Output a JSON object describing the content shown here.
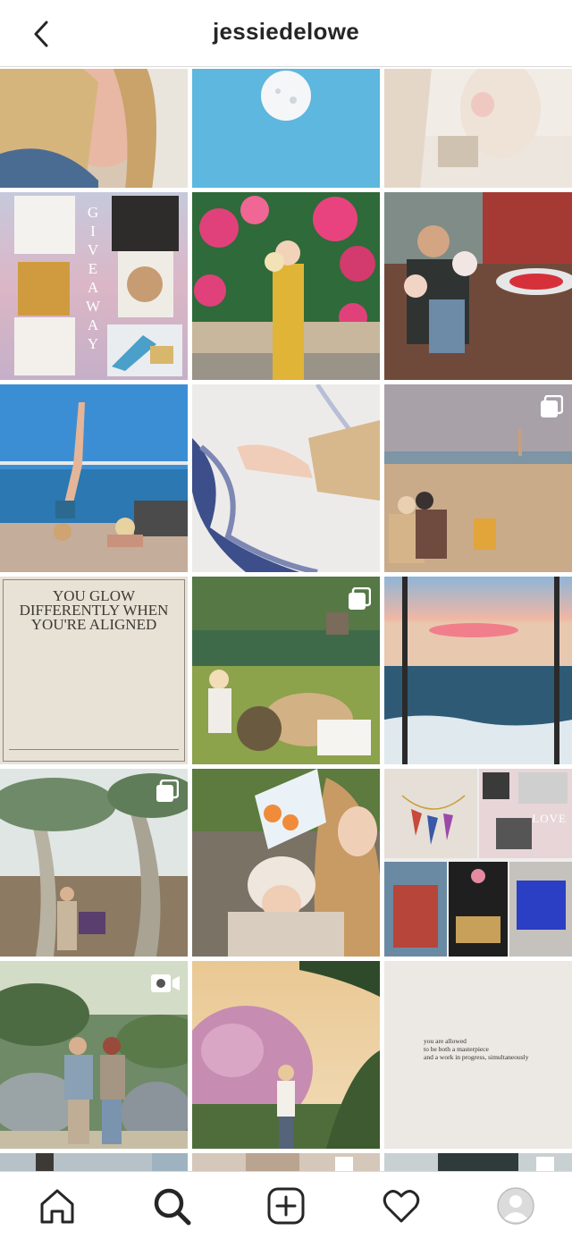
{
  "header": {
    "back_icon": "chevron-left-icon",
    "title": "jessiedelowe"
  },
  "grid": {
    "posts": [
      {
        "index": 1,
        "badge": "none"
      },
      {
        "index": 2,
        "badge": "none"
      },
      {
        "index": 3,
        "badge": "none"
      },
      {
        "index": 4,
        "badge": "none",
        "text": {
          "giveaway": [
            "G",
            "I",
            "V",
            "E",
            "A",
            "W",
            "A",
            "Y"
          ]
        }
      },
      {
        "index": 5,
        "badge": "none"
      },
      {
        "index": 6,
        "badge": "none"
      },
      {
        "index": 7,
        "badge": "none"
      },
      {
        "index": 8,
        "badge": "none"
      },
      {
        "index": 9,
        "badge": "carousel-icon"
      },
      {
        "index": 10,
        "badge": "none",
        "quote": "YOU GLOW DIFFERENTLY WHEN YOU'RE ALIGNED"
      },
      {
        "index": 11,
        "badge": "carousel-icon"
      },
      {
        "index": 12,
        "badge": "none"
      },
      {
        "index": 13,
        "badge": "carousel-icon"
      },
      {
        "index": 14,
        "badge": "none"
      },
      {
        "index": 15,
        "badge": "none",
        "text": {
          "love": "LOVE"
        }
      },
      {
        "index": 16,
        "badge": "video-icon"
      },
      {
        "index": 17,
        "badge": "none"
      },
      {
        "index": 18,
        "badge": "none",
        "quote_lines": [
          "you are allowed",
          "to be both a masterpiece",
          "and a work in progress, simultaneously"
        ]
      }
    ]
  },
  "bottom_nav": {
    "items": [
      {
        "name": "home",
        "icon": "home-icon"
      },
      {
        "name": "search",
        "icon": "search-icon",
        "active": true
      },
      {
        "name": "new-post",
        "icon": "add-post-icon"
      },
      {
        "name": "activity",
        "icon": "heart-icon"
      },
      {
        "name": "profile",
        "icon": "avatar-icon"
      }
    ]
  },
  "colors": {
    "header_text": "#262626",
    "divider": "#dbdbdb",
    "icon": "#262626"
  }
}
